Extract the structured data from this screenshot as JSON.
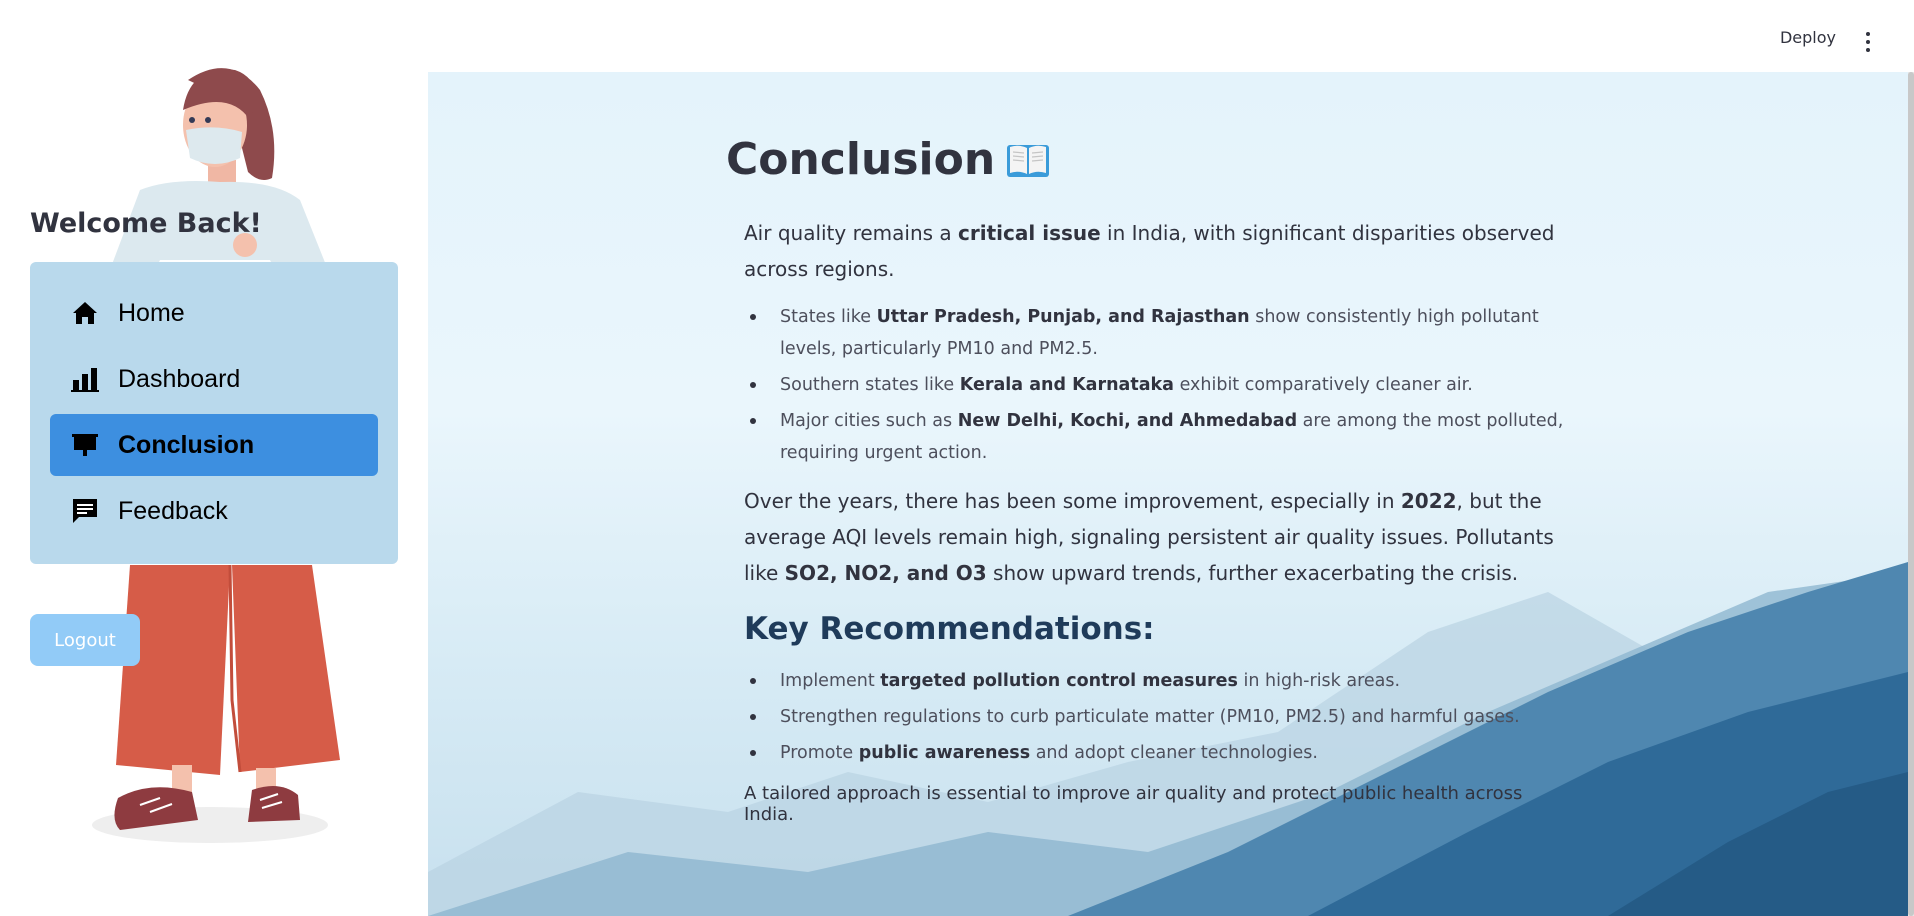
{
  "header": {
    "deploy_label": "Deploy"
  },
  "sidebar": {
    "welcome": "Welcome Back!",
    "items": [
      {
        "label": "Home",
        "icon": "home-icon",
        "active": false
      },
      {
        "label": "Dashboard",
        "icon": "bar-chart-icon",
        "active": false
      },
      {
        "label": "Conclusion",
        "icon": "presentation-icon",
        "active": true
      },
      {
        "label": "Feedback",
        "icon": "chat-icon",
        "active": false
      }
    ],
    "logout_label": "Logout"
  },
  "main": {
    "title": "Conclusion",
    "intro": {
      "t1": "Air quality remains a ",
      "b1": "critical issue",
      "t2": " in India, with significant disparities observed across regions."
    },
    "findings": [
      {
        "pre": "States like ",
        "bold": "Uttar Pradesh, Punjab, and Rajasthan",
        "post": " show consistently high pollutant levels, particularly PM10 and PM2.5."
      },
      {
        "pre": "Southern states like ",
        "bold": "Kerala and Karnataka",
        "post": " exhibit comparatively cleaner air."
      },
      {
        "pre": "Major cities such as ",
        "bold": "New Delhi, Kochi, and Ahmedabad",
        "post": " are among the most polluted, requiring urgent action."
      }
    ],
    "trend": {
      "t1": "Over the years, there has been some improvement, especially in ",
      "b1": "2022",
      "t2": ", but the average AQI levels remain high, signaling persistent air quality issues. Pollutants like ",
      "b2": "SO2, NO2, and O3",
      "t3": " show upward trends, further exacerbating the crisis."
    },
    "recommendations_heading": "Key Recommendations:",
    "recommendations": [
      {
        "pre": "Implement ",
        "bold": "targeted pollution control measures",
        "post": " in high-risk areas."
      },
      {
        "pre": "Strengthen regulations to curb particulate matter (PM10, PM2.5) and harmful gases.",
        "bold": "",
        "post": ""
      },
      {
        "pre": "Promote ",
        "bold": "public awareness",
        "post": " and adopt cleaner technologies."
      }
    ],
    "closing": "A tailored approach is essential to improve air quality and protect public health across India."
  },
  "colors": {
    "nav_panel_bg": "#b9d9ec",
    "nav_active_bg": "#3d8fe0",
    "logout_bg": "#92cbf7",
    "heading_color": "#1f3b5a"
  }
}
